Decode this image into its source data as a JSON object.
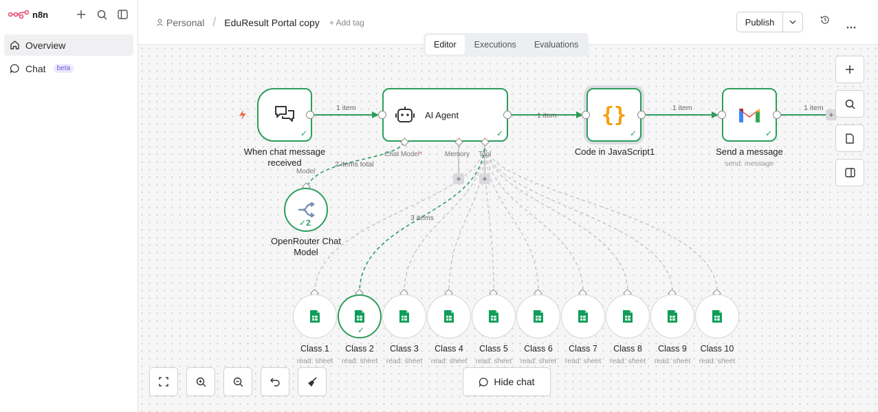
{
  "sidebar": {
    "logo_text": "n8n",
    "items": [
      {
        "label": "Overview",
        "icon": "home-icon"
      },
      {
        "label": "Chat",
        "icon": "chat-bubble-icon",
        "badge": "beta"
      }
    ]
  },
  "header": {
    "breadcrumb_parent": "Personal",
    "workflow_title": "EduResult Portal copy",
    "add_tag": "+ Add tag",
    "publish_label": "Publish"
  },
  "tabs": [
    {
      "label": "Editor",
      "active": true
    },
    {
      "label": "Executions",
      "active": false
    },
    {
      "label": "Evaluations",
      "active": false
    }
  ],
  "nodes": {
    "trigger": {
      "label": "When chat message received"
    },
    "agent": {
      "label": "AI Agent",
      "ports": {
        "chat_model": "Chat Model",
        "memory": "Memory",
        "tool": "Tool"
      }
    },
    "code": {
      "label": "Code in JavaScript1"
    },
    "gmail": {
      "label": "Send a message",
      "sub": "send: message"
    },
    "openrouter": {
      "label_line1": "OpenRouter Chat",
      "label_line2": "Model",
      "port_label": "Model",
      "run_count": "2"
    }
  },
  "trigger_label_line1": "When chat message",
  "trigger_label_line2": "received",
  "edge_labels": {
    "trigger_agent": "1 item",
    "agent_code": "1 item",
    "code_gmail": "1 item",
    "gmail_out": "1 item",
    "model_total": "2 items total",
    "tool_items": "3 items"
  },
  "tools": [
    {
      "label": "Class 1",
      "sub": "read: sheet",
      "executed": false
    },
    {
      "label": "Class 2",
      "sub": "read: sheet",
      "executed": true
    },
    {
      "label": "Class 3",
      "sub": "read: sheet",
      "executed": false
    },
    {
      "label": "Class 4",
      "sub": "read: sheet",
      "executed": false
    },
    {
      "label": "Class 5",
      "sub": "read: sheet",
      "executed": false
    },
    {
      "label": "Class 6",
      "sub": "read: sheet",
      "executed": false
    },
    {
      "label": "Class 7",
      "sub": "read: sheet",
      "executed": false
    },
    {
      "label": "Class 8",
      "sub": "read: sheet",
      "executed": false
    },
    {
      "label": "Class 9",
      "sub": "read: sheet",
      "executed": false
    },
    {
      "label": "Class 10",
      "sub": "read: sheet",
      "executed": false
    }
  ],
  "hide_chat_label": "Hide chat",
  "colors": {
    "accent_green": "#2a9d5b",
    "brand_pink": "#ea4b71",
    "code_orange": "#f59e0b",
    "sheets_green": "#0f9d58"
  }
}
